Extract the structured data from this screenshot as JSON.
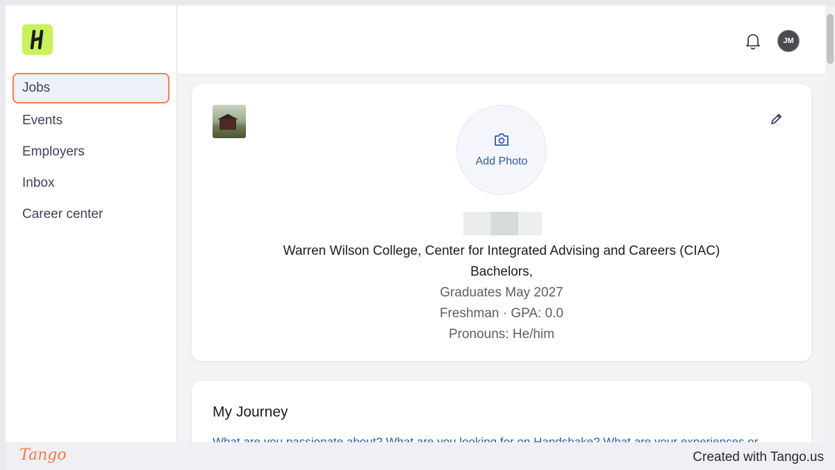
{
  "app": {
    "logo_letter": "H",
    "brand_color": "#c8f15a"
  },
  "sidebar": {
    "items": [
      {
        "label": "Jobs",
        "active": true
      },
      {
        "label": "Events"
      },
      {
        "label": "Employers"
      },
      {
        "label": "Inbox"
      },
      {
        "label": "Career center"
      }
    ]
  },
  "header": {
    "bell_icon": "bell-icon",
    "avatar_initials": "JM"
  },
  "profile": {
    "add_photo_label": "Add Photo",
    "school": "Warren Wilson College, Center for Integrated Advising and Careers (CIAC)",
    "degree": "Bachelors,",
    "graduation": "Graduates May 2027",
    "year_gpa": "Freshman · GPA: 0.0",
    "pronouns": "Pronouns: He/him"
  },
  "journey": {
    "title": "My Journey",
    "prompt": "What are you passionate about? What are you looking for on Handshake? What are your experiences or"
  },
  "footer": {
    "tango_logo": "Tango",
    "created_text": "Created with Tango.us"
  },
  "colors": {
    "highlight": "#f0804a",
    "link": "#2a5caa"
  }
}
